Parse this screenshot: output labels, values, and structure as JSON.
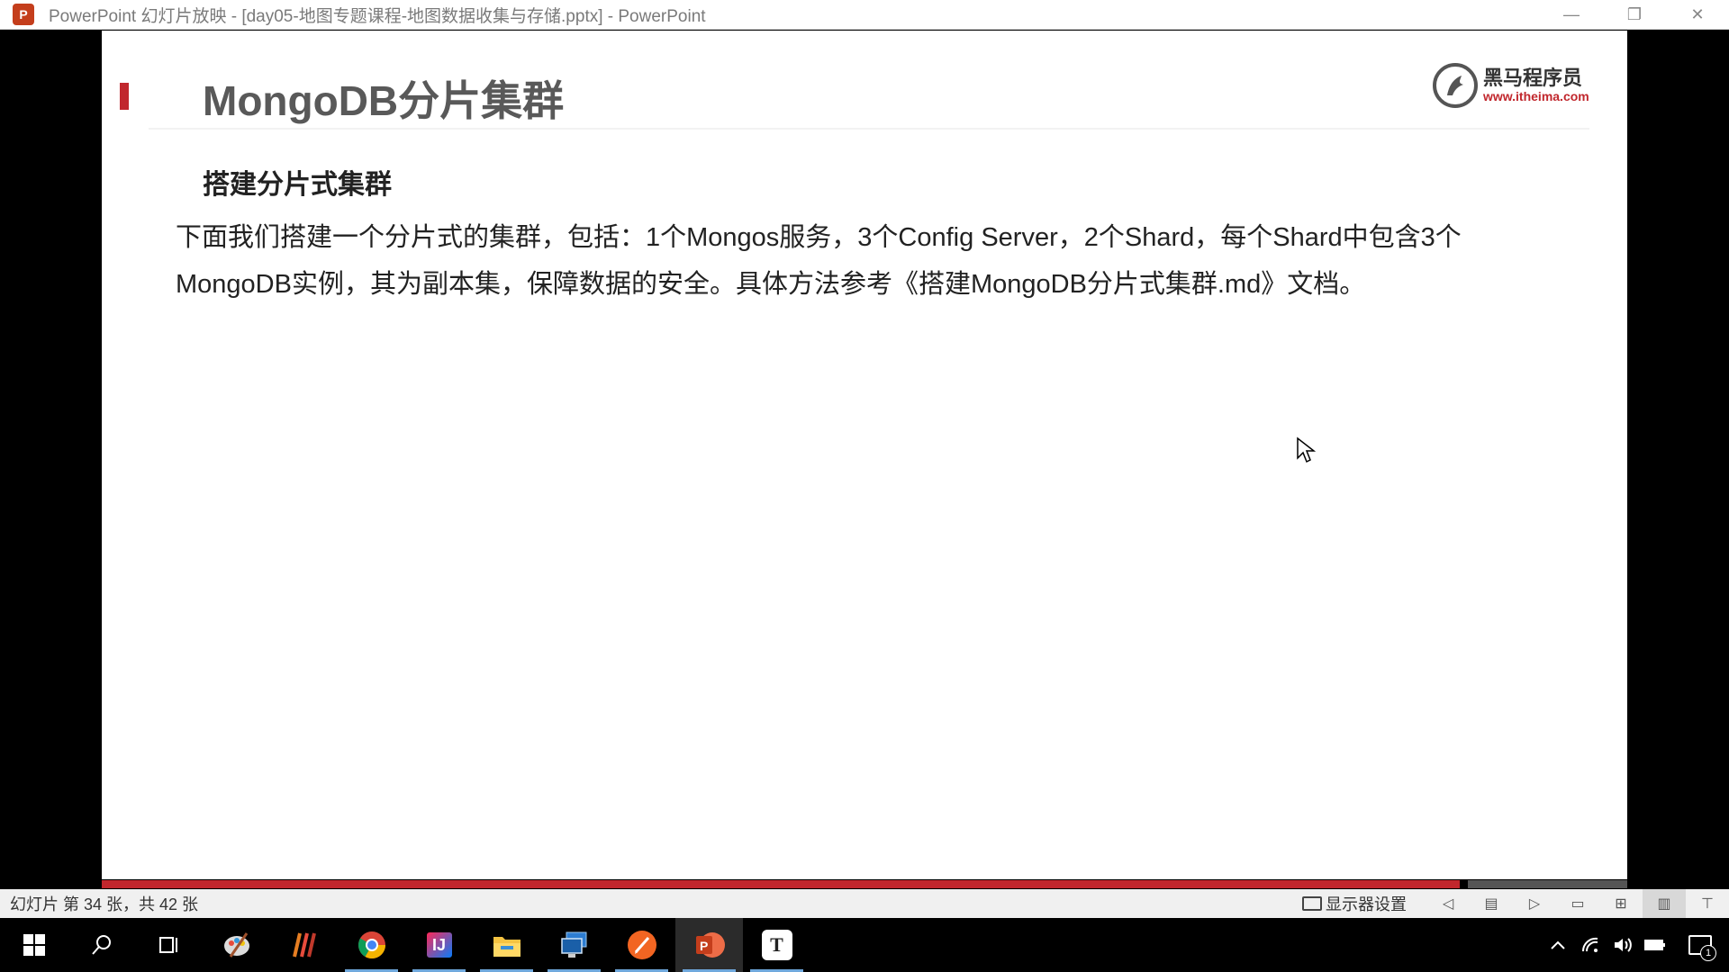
{
  "window": {
    "app_icon_letter": "P",
    "title": "PowerPoint 幻灯片放映 - [day05-地图专题课程-地图数据收集与存储.pptx] - PowerPoint",
    "minimize": "—",
    "restore": "❐",
    "close": "✕"
  },
  "slide": {
    "title": "MongoDB分片集群",
    "logo": {
      "name": "黑马程序员",
      "url": "www.itheima.com"
    },
    "subheading": "搭建分片式集群",
    "body": "下面我们搭建一个分片式的集群，包括：1个Mongos服务，3个Config Server，2个Shard，每个Shard中包含3个MongoDB实例，其为副本集，保障数据的安全。具体方法参考《搭建MongoDB分片式集群.md》文档。",
    "colors": {
      "accent": "#c1272d",
      "title": "#595959"
    }
  },
  "progress": {
    "current_slide": 34,
    "total_slides": 42
  },
  "statusbar": {
    "slide_counter": "幻灯片 第 34 张，共 42 张",
    "display_settings": "显示器设置",
    "icons": [
      "prev-icon",
      "notes-icon",
      "next-icon",
      "normal-view-icon",
      "slide-sorter-icon",
      "reading-view-icon",
      "slideshow-icon"
    ]
  },
  "taskbar": {
    "items": [
      "start-icon",
      "search-icon",
      "task-view-icon",
      "paint-icon",
      "app-icon",
      "chrome-icon",
      "intellij-icon",
      "file-explorer-icon",
      "remote-desktop-icon",
      "sketch-icon",
      "powerpoint-icon",
      "typora-icon"
    ],
    "typora_letter": "T",
    "intellij_letters": "IJ",
    "notification_count": "1"
  }
}
